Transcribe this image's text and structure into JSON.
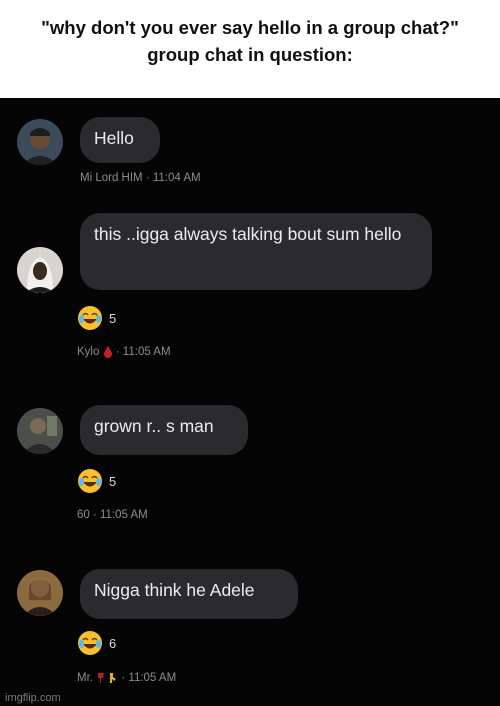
{
  "caption": {
    "line1": "\"why don't you ever say hello in a group chat?\"",
    "line2": "group chat in question:"
  },
  "messages": [
    {
      "text": "Hello",
      "meta": "Mi Lord HIM · 11:04 AM",
      "avatar_icon": "user-avatar-photo"
    },
    {
      "text": "this ..igga always talking bout sum hello",
      "reaction": {
        "emoji": "joy-emoji",
        "count": "5"
      },
      "meta_name": "Kylo",
      "meta_time": "· 11:05 AM",
      "avatar_icon": "user-avatar-photo"
    },
    {
      "text": "grown r.. s man",
      "reaction": {
        "emoji": "joy-emoji",
        "count": "5"
      },
      "meta": "60 · 11:05 AM",
      "avatar_icon": "user-avatar-photo"
    },
    {
      "text": "Nigga think he Adele",
      "reaction": {
        "emoji": "joy-emoji",
        "count": "6"
      },
      "meta_name": "Mr.",
      "meta_time": "· 11:05 AM",
      "avatar_icon": "user-avatar-photo"
    }
  ],
  "watermark": "imgflip.com",
  "colors": {
    "chat_background": "#050505",
    "bubble": "#2b2b2f",
    "bubble_text": "#ececec",
    "meta_text": "#8c8c8c",
    "emoji_yellow": "#f7c02c"
  }
}
